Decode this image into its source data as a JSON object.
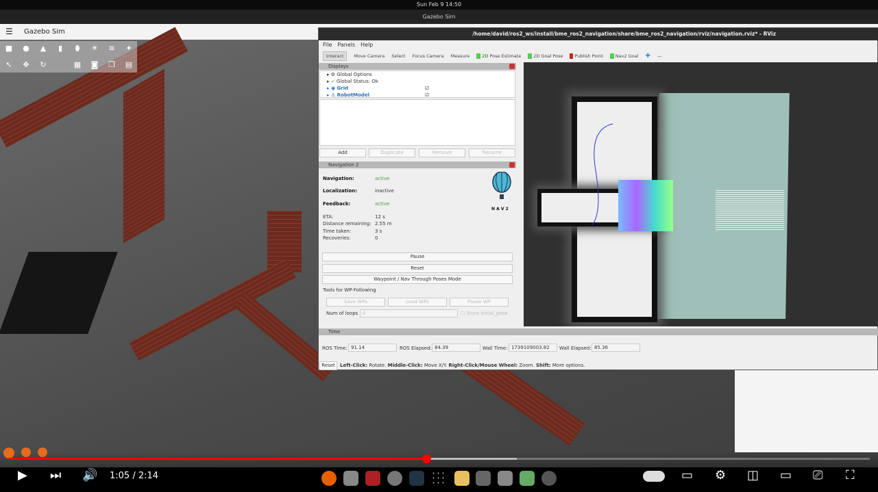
{
  "system": {
    "clock": "Sun Feb 9  14:50"
  },
  "gazebo": {
    "window_title": "Gazebo Sim",
    "app_title": "Gazebo Sim"
  },
  "rviz": {
    "title": "/home/david/ros2_ws/install/bme_ros2_navigation/share/bme_ros2_navigation/rviz/navigation.rviz* - RViz",
    "menu": [
      "File",
      "Panels",
      "Help"
    ],
    "toolbar": [
      "Interact",
      "Move Camera",
      "Select",
      "Focus Camera",
      "Measure",
      "2D Pose Estimate",
      "2D Goal Pose",
      "Publish Point",
      "Nav2 Goal"
    ],
    "displays": {
      "title": "Displays",
      "items": [
        {
          "label": "Global Options",
          "checked": false
        },
        {
          "label": "Global Status: Ok",
          "checked": false
        },
        {
          "label": "Grid",
          "checked": true
        },
        {
          "label": "RobotModel",
          "checked": true
        }
      ],
      "buttons": [
        "Add",
        "Duplicate",
        "Remove",
        "Rename"
      ]
    },
    "nav2": {
      "title": "Navigation 2",
      "status": [
        {
          "label": "Navigation:",
          "value": "active"
        },
        {
          "label": "Localization:",
          "value": "inactive"
        },
        {
          "label": "Feedback:",
          "value": "active"
        }
      ],
      "metrics": [
        {
          "label": "ETA:",
          "value": "12 s"
        },
        {
          "label": "Distance remaining:",
          "value": "2.55 m"
        },
        {
          "label": "Time taken:",
          "value": "3 s"
        },
        {
          "label": "Recoveries:",
          "value": "0"
        }
      ],
      "logo_text": "N A V 2",
      "buttons": [
        "Pause",
        "Reset",
        "Waypoint / Nav Through Poses Mode"
      ],
      "wp_title": "Tools for WP-Following",
      "wp_buttons": [
        "Save WPs",
        "Load WPs",
        "Pause WP"
      ],
      "loops_label": "Num of loops",
      "loops_value": "0",
      "store_label": "Store initial_pose"
    },
    "time": {
      "title": "Time",
      "fields": [
        {
          "label": "ROS Time:",
          "value": "91.14"
        },
        {
          "label": "ROS Elapsed:",
          "value": "84.39"
        },
        {
          "label": "Wall Time:",
          "value": "1739109003.82"
        },
        {
          "label": "Wall Elapsed:",
          "value": "85.36"
        }
      ]
    },
    "status": {
      "reset": "Reset",
      "k1": "Left-Click:",
      "v1": " Rotate. ",
      "k2": "Middle-Click:",
      "v2": " Move X/Y. ",
      "k3": "Right-Click/Mouse Wheel:",
      "v3": " Zoom. ",
      "k4": "Shift:",
      "v4": " More options."
    }
  },
  "video": {
    "time": "1:05 / 2:14",
    "progress": 0.485,
    "buffered": 0.59,
    "accent": "#ff0000"
  }
}
